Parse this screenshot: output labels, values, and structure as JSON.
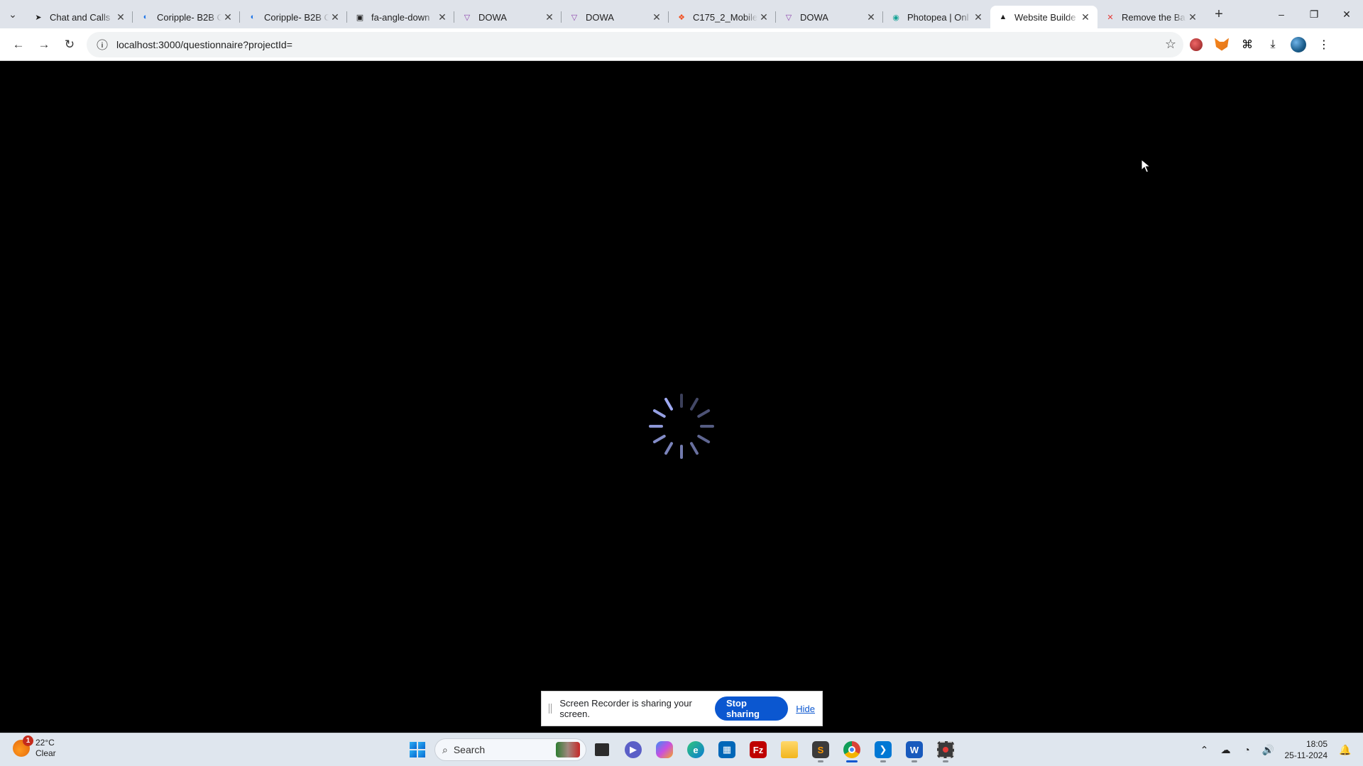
{
  "browser": {
    "tabs": [
      {
        "title": "Chat and Calls",
        "favicon": "chat-arrow-icon",
        "color": "#1f1f1f"
      },
      {
        "title": "Coripple- B2B C",
        "favicon": "coripple-icon",
        "color": "#1a73e8"
      },
      {
        "title": "Coripple- B2B C",
        "favicon": "coripple-icon",
        "color": "#1a73e8"
      },
      {
        "title": "fa-angle-down",
        "favicon": "fontawesome-icon",
        "color": "#1f1f1f"
      },
      {
        "title": "DOWA",
        "favicon": "dowa-icon",
        "color": "#8e44ad"
      },
      {
        "title": "DOWA",
        "favicon": "dowa-icon",
        "color": "#8e44ad"
      },
      {
        "title": "C175_2_Mobile",
        "favicon": "figma-icon",
        "color": "#f24e1e"
      },
      {
        "title": "DOWA",
        "favicon": "dowa-icon",
        "color": "#8e44ad"
      },
      {
        "title": "Photopea | Onl",
        "favicon": "photopea-icon",
        "color": "#18a497"
      },
      {
        "title": "Website Builde",
        "favicon": "builder-icon",
        "color": "#1f1f1f",
        "active": true
      },
      {
        "title": "Remove the Ba",
        "favicon": "remove-bg-icon",
        "color": "#e53935"
      }
    ],
    "address": {
      "url": "localhost:3000/questionnaire?projectId="
    }
  },
  "sharebar": {
    "message": "Screen Recorder is sharing your screen.",
    "stop_label": "Stop sharing",
    "hide_label": "Hide"
  },
  "taskbar": {
    "weather": {
      "temp": "22°C",
      "condition": "Clear",
      "badge": "1"
    },
    "search_label": "Search",
    "clock": {
      "time": "18:05",
      "date": "25-11-2024"
    }
  },
  "colors": {
    "accent": "#0b57d0",
    "spinner": "#a8b4ff"
  }
}
